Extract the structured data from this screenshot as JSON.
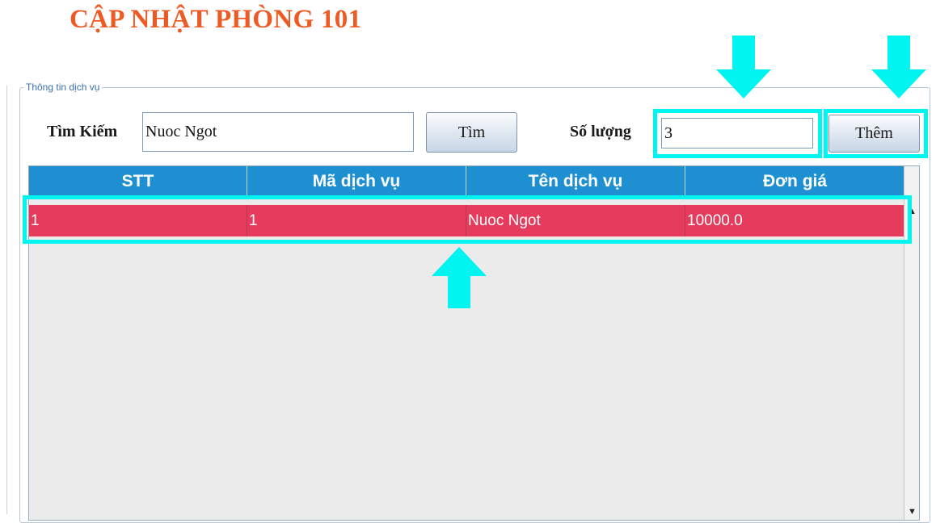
{
  "page_title": "CẬP NHẬT PHÒNG 101",
  "fieldset_legend": "Thông tin dịch vụ",
  "search": {
    "label": "Tìm Kiếm",
    "value": "Nuoc Ngot",
    "button_label": "Tìm"
  },
  "quantity": {
    "label": "Số lượng",
    "value": "3",
    "button_label": "Thêm"
  },
  "table": {
    "columns": [
      "STT",
      "Mã dịch vụ",
      "Tên dịch vụ",
      "Đơn giá"
    ],
    "rows": [
      {
        "stt": "1",
        "ma": "1",
        "ten": "Nuoc Ngot",
        "don_gia": "10000.0"
      }
    ]
  },
  "colors": {
    "title": "#ee5a24",
    "header_bg": "#1e90d2",
    "selected_row": "#e63b5c",
    "highlight": "#00f4f0"
  },
  "icons": {
    "scroll_up": "▲",
    "scroll_down": "▼"
  }
}
